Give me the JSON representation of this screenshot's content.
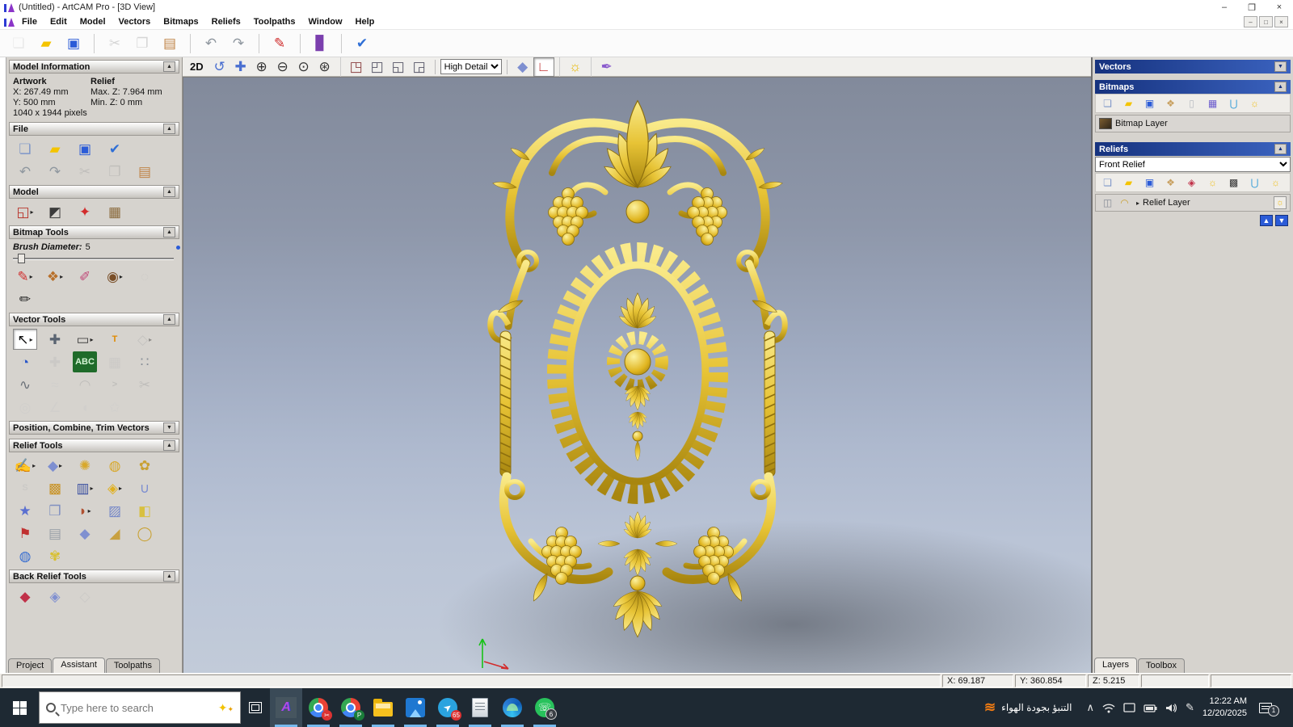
{
  "window": {
    "title": "(Untitled) - ArtCAM Pro - [3D View]"
  },
  "icons": {
    "collapse_up": "▲",
    "collapse_down": "▼",
    "flyout": "▸",
    "minimize": "–",
    "restore": "❐",
    "maximize": "□",
    "close": "×",
    "chevron_up": "∧",
    "pen": "✎"
  },
  "menu": {
    "items": [
      {
        "n": "menu-file",
        "t": "File"
      },
      {
        "n": "menu-edit",
        "t": "Edit"
      },
      {
        "n": "menu-model",
        "t": "Model"
      },
      {
        "n": "menu-vectors",
        "t": "Vectors"
      },
      {
        "n": "menu-bitmaps",
        "t": "Bitmaps"
      },
      {
        "n": "menu-reliefs",
        "t": "Reliefs"
      },
      {
        "n": "menu-toolpaths",
        "t": "Toolpaths"
      },
      {
        "n": "menu-window",
        "t": "Window"
      },
      {
        "n": "menu-help",
        "t": "Help"
      }
    ]
  },
  "main_toolbar": {
    "tools": [
      {
        "n": "new-model-button",
        "g": "❏",
        "c": "#c7d0df",
        "d": true
      },
      {
        "n": "open-model-button",
        "g": "▰",
        "c": "#f4c400"
      },
      {
        "n": "save-model-button",
        "g": "▣",
        "c": "#2b5bd7"
      },
      {
        "sep": true
      },
      {
        "n": "cut-button",
        "g": "✂",
        "c": "#98a0a8",
        "d": true
      },
      {
        "n": "copy-button",
        "g": "❐",
        "c": "#98a0a8",
        "d": true
      },
      {
        "n": "paste-button",
        "g": "▤",
        "c": "#c08448"
      },
      {
        "sep": true
      },
      {
        "n": "undo-button",
        "g": "↶",
        "c": "#8f979f"
      },
      {
        "n": "redo-button",
        "g": "↷",
        "c": "#8f979f"
      },
      {
        "sep": true
      },
      {
        "n": "notes-button",
        "g": "✎",
        "c": "#cf2b2b"
      },
      {
        "sep": true
      },
      {
        "n": "reference-help-button",
        "g": "▊",
        "c": "#7b3fae"
      },
      {
        "sep": true
      },
      {
        "n": "model-setup-button",
        "g": "✔",
        "c": "#2f6fd6"
      }
    ]
  },
  "assistant": {
    "model_information": {
      "title": "Model Information",
      "artwork_label": "Artwork",
      "relief_label": "Relief",
      "artwork_x": "X: 267.49 mm",
      "artwork_y": "Y: 500 mm",
      "relief_max": "Max. Z: 7.964 mm",
      "relief_min": "Min. Z: 0 mm",
      "pixels": "1040 x 1944 pixels"
    },
    "file": {
      "title": "File",
      "rows": [
        [
          {
            "n": "file-new-button",
            "g": "❏",
            "c": "#7d96c9"
          },
          {
            "n": "file-open-button",
            "g": "▰",
            "c": "#f4c400"
          },
          {
            "n": "file-save-button",
            "g": "▣",
            "c": "#2b5bd7"
          },
          {
            "n": "file-model-setup-button",
            "g": "✔",
            "c": "#2f6fd6"
          }
        ],
        [
          {
            "n": "file-undo-button",
            "g": "↶",
            "c": "#8f979f"
          },
          {
            "n": "file-redo-button",
            "g": "↷",
            "c": "#8f979f"
          },
          {
            "n": "file-cut-button",
            "g": "✂",
            "c": "#9aa2aa",
            "d": true
          },
          {
            "n": "file-copy-button",
            "g": "❐",
            "c": "#9aa2aa",
            "d": true
          },
          {
            "n": "file-paste-button",
            "g": "▤",
            "c": "#c08448"
          }
        ]
      ]
    },
    "model": {
      "title": "Model",
      "rows": [
        [
          {
            "n": "set-model-size-button",
            "g": "◱",
            "c": "#b8352c",
            "f": true
          },
          {
            "n": "adjust-model-lighting-button",
            "g": "◩",
            "c": "#3b3b3b"
          },
          {
            "n": "set-light-button",
            "g": "✦",
            "c": "#d22b2b"
          },
          {
            "n": "load-reference-image-button",
            "g": "▦",
            "c": "#8a6a3c"
          }
        ]
      ]
    },
    "bitmap_tools": {
      "title": "Bitmap Tools",
      "brush_label": "Brush Diameter:",
      "brush_value": "5",
      "rows": [
        [
          {
            "n": "paint-button",
            "g": "✎",
            "c": "#d03030",
            "f": true
          },
          {
            "n": "paint-selective-button",
            "g": "❖",
            "c": "#b8702a",
            "f": true
          },
          {
            "n": "colour-picker-button",
            "g": "✐",
            "c": "#c04878"
          },
          {
            "n": "palette-button",
            "g": "◉",
            "c": "#7a4f28",
            "f": true
          },
          {
            "n": "flood-fill-button",
            "g": "◌",
            "c": "#b8bcc2",
            "d": true
          }
        ],
        [
          {
            "n": "draw-button",
            "g": "✏",
            "c": "#222222"
          }
        ]
      ]
    },
    "vector_tools": {
      "title": "Vector Tools",
      "rows": [
        [
          {
            "n": "select-vectors-button",
            "g": "↖",
            "c": "#111111",
            "sel": true,
            "f": true
          },
          {
            "n": "transform-vectors-button",
            "g": "✚",
            "c": "#5a6472"
          },
          {
            "n": "create-rectangle-button",
            "g": "▭",
            "c": "#444444",
            "f": true
          },
          {
            "n": "create-text-button",
            "t": "T",
            "c": "#e08a00"
          },
          {
            "n": "envelope-distort-button",
            "g": "◇",
            "c": "#aaaabb",
            "d": true,
            "f": true
          }
        ],
        [
          {
            "n": "measure-button",
            "g": "◔",
            "c": "#2a57c9"
          },
          {
            "n": "snap-button",
            "g": "✚",
            "c": "#b8bcc2",
            "d": true
          },
          {
            "n": "text-block-button",
            "t": "ABC",
            "c": "#d6f5d6",
            "bg": "#1f6b2a"
          },
          {
            "n": "wireframe-button",
            "g": "▦",
            "c": "#b8bcc2",
            "d": true
          },
          {
            "n": "block-copy-button",
            "g": "∷",
            "c": "#8a9098"
          }
        ],
        [
          {
            "n": "create-polyline-button",
            "g": "∿",
            "c": "#6a7078"
          },
          {
            "n": "freehand-polyline-button",
            "g": "≈",
            "c": "#c6cad0",
            "d": true
          },
          {
            "n": "create-arc-button",
            "g": "◠",
            "c": "#9aa0a8",
            "d": true
          },
          {
            "n": "sharp-corner-button",
            "t": ">",
            "c": "#9aa0a8",
            "d": true
          },
          {
            "n": "cut-vector-button",
            "g": "✂",
            "c": "#9aa0a8",
            "d": true
          }
        ],
        [
          {
            "n": "revolve-vector-button",
            "g": "◎",
            "c": "#c6cad0",
            "d": true
          },
          {
            "n": "node-editing-button",
            "g": "∠",
            "c": "#c6cad0",
            "d": true
          },
          {
            "n": "mirror-vectors-button",
            "g": "◖",
            "c": "#c6cad0",
            "d": true
          },
          {
            "n": "create-star-button",
            "g": "✩",
            "c": "#c6cad0",
            "d": true
          }
        ]
      ]
    },
    "position_section": {
      "title": "Position, Combine, Trim Vectors"
    },
    "relief_tools": {
      "title": "Relief Tools",
      "rows": [
        [
          {
            "n": "sculpt-button",
            "g": "✍",
            "c": "#c9a132",
            "f": true
          },
          {
            "n": "zero-plane-button",
            "g": "◆",
            "c": "#7e8fd0",
            "f": true
          },
          {
            "n": "spin-relief-button",
            "g": "✺",
            "c": "#d8a82a"
          },
          {
            "n": "dome-relief-button",
            "g": "◍",
            "c": "#d8a82a"
          },
          {
            "n": "smooth-relief-button",
            "g": "✿",
            "c": "#c9a132"
          }
        ],
        [
          {
            "n": "sculpt-smooth-button",
            "t": "S",
            "c": "#b8bcc2",
            "d": true
          },
          {
            "n": "weave-wizard-button",
            "g": "▩",
            "c": "#c8901f"
          },
          {
            "n": "relief-clipart-button",
            "g": "▥",
            "c": "#3a4fa0",
            "f": true
          },
          {
            "n": "two-rail-sweep-button",
            "g": "◈",
            "c": "#e0b020",
            "f": true
          },
          {
            "n": "unwrap-relief-button",
            "g": "∪",
            "c": "#7e8fd0"
          }
        ],
        [
          {
            "n": "star-wizard-button",
            "g": "★",
            "c": "#5a6fd0"
          },
          {
            "n": "stamp-relief-button",
            "g": "❒",
            "c": "#8090c0"
          },
          {
            "n": "carve-relief-button",
            "g": "◗",
            "c": "#b05030",
            "f": true
          },
          {
            "n": "texture-relief-button",
            "g": "▨",
            "c": "#7285c8"
          },
          {
            "n": "offset-relief-button",
            "g": "◧",
            "c": "#d8c040"
          }
        ],
        [
          {
            "n": "turn-relief-button",
            "g": "⚑",
            "c": "#c03030"
          },
          {
            "n": "column-relief-button",
            "g": "▤",
            "c": "#9aa0a8"
          },
          {
            "n": "pillow-relief-button",
            "g": "◆",
            "c": "#8090d0"
          },
          {
            "n": "angled-plane-button",
            "g": "◢",
            "c": "#c8a040"
          },
          {
            "n": "ring-wizard-button",
            "g": "◯",
            "c": "#c9a132"
          }
        ],
        [
          {
            "n": "texture-sphere-button",
            "g": "◍",
            "c": "#3a6fd0"
          },
          {
            "n": "wrap-flower-button",
            "g": "✾",
            "c": "#d8c030"
          }
        ]
      ]
    },
    "back_relief_tools": {
      "title": "Back Relief Tools",
      "rows": [
        [
          {
            "n": "back-relief-invert-button",
            "g": "◆",
            "c": "#c03048"
          },
          {
            "n": "back-relief-offset-button",
            "g": "◈",
            "c": "#8090d0"
          },
          {
            "n": "back-relief-blank-button",
            "g": "◇",
            "c": "#b8bcc2",
            "d": true
          }
        ]
      ]
    },
    "tabs": {
      "project": "Project",
      "assistant": "Assistant",
      "toolpaths": "Toolpaths"
    }
  },
  "canvas": {
    "toolbar": {
      "label_2d": "2D",
      "detail_selector": "High Detail",
      "nav_tools": [
        {
          "n": "twiddle-view-button",
          "g": "↺",
          "c": "#4a6fd0"
        },
        {
          "n": "pan-view-button",
          "g": "✚",
          "c": "#4a6fd0"
        },
        {
          "n": "zoom-in-button",
          "g": "⊕",
          "c": "#333333"
        },
        {
          "n": "zoom-out-button",
          "g": "⊖",
          "c": "#333333"
        },
        {
          "n": "zoom-previous-button",
          "g": "⊙",
          "c": "#333333"
        },
        {
          "n": "zoom-fit-button",
          "g": "⊛",
          "c": "#333333"
        },
        {
          "sep": true
        },
        {
          "n": "view-top-button",
          "g": "◳",
          "c": "#8a4040"
        },
        {
          "n": "view-iso1-button",
          "g": "◰",
          "c": "#555566"
        },
        {
          "n": "view-iso2-button",
          "g": "◱",
          "c": "#555566"
        },
        {
          "n": "view-iso3-button",
          "g": "◲",
          "c": "#555566"
        }
      ],
      "right_tools": [
        {
          "n": "toggle-relief-view-button",
          "g": "◆",
          "c": "#7e8fd0"
        },
        {
          "n": "draw-axes-button",
          "g": "∟",
          "c": "#c03030",
          "sel": true
        },
        {
          "sep": true
        },
        {
          "n": "toggle-lighting-button",
          "g": "☼",
          "c": "#e8b800"
        },
        {
          "sep": true
        },
        {
          "n": "shade-relief-button",
          "g": "✒",
          "c": "#8a5acd"
        }
      ]
    }
  },
  "right_panel": {
    "vectors": {
      "title": "Vectors"
    },
    "bitmaps": {
      "title": "Bitmaps",
      "layer_name": "Bitmap Layer",
      "tools": [
        {
          "n": "new-bitmap-layer-button",
          "g": "❏",
          "c": "#7d96c9"
        },
        {
          "n": "open-bitmap-layer-button",
          "g": "▰",
          "c": "#f4c400"
        },
        {
          "n": "save-bitmap-layer-button",
          "g": "▣",
          "c": "#2b5bd7"
        },
        {
          "n": "bitmap-layer-tool-button",
          "g": "❖",
          "c": "#c8a060"
        },
        {
          "n": "clear-bitmap-layer-button",
          "g": "▯",
          "c": "#b8bcc2"
        },
        {
          "n": "edit-bitmap-layer-button",
          "g": "▦",
          "c": "#6a5acd"
        },
        {
          "n": "delete-bitmap-layer-button",
          "g": "⋃",
          "c": "#3a9fd8"
        },
        {
          "n": "toggle-bitmaps-visibility-button",
          "g": "☼",
          "c": "#f0c020"
        }
      ]
    },
    "reliefs": {
      "title": "Reliefs",
      "selected_relief": "Front Relief",
      "layer_name": "Relief Layer",
      "tools": [
        {
          "n": "new-relief-layer-button",
          "g": "❏",
          "c": "#7d96c9"
        },
        {
          "n": "open-relief-layer-button",
          "g": "▰",
          "c": "#f4c400"
        },
        {
          "n": "save-relief-layer-button",
          "g": "▣",
          "c": "#2b5bd7"
        },
        {
          "n": "relief-layer-tool-button",
          "g": "❖",
          "c": "#c8a060"
        },
        {
          "n": "merge-relief-layers-button",
          "g": "◈",
          "c": "#c03048"
        },
        {
          "n": "relief-visibility-button",
          "g": "☼",
          "c": "#f0c020"
        },
        {
          "n": "greyscale-preview-button",
          "g": "▩",
          "c": "#333333"
        },
        {
          "n": "delete-relief-layer-button",
          "g": "⋃",
          "c": "#3a9fd8"
        },
        {
          "n": "toggle-reliefs-visibility-button",
          "g": "☼",
          "c": "#f0c020"
        }
      ],
      "layer_tools": [
        {
          "n": "relief-layer-mode-button",
          "g": "◫",
          "c": "#8a8f98"
        },
        {
          "n": "add-relief-layer-button",
          "g": "◠",
          "c": "#c9a132"
        }
      ]
    },
    "tabs": {
      "layers": "Layers",
      "toolbox": "Toolbox"
    }
  },
  "status_bar": {
    "x": "X: 69.187",
    "y": "Y: 360.854",
    "z": "Z: 5.215"
  },
  "taskbar": {
    "search_placeholder": "Type here to search",
    "weather_text": "التنبؤ بجودة الهواء",
    "time": "12:22 AM",
    "date": "12/20/2025",
    "telegram_badge": "65",
    "whatsapp_badge": "6",
    "notification_badge": "1",
    "chrome_profile_letter": "P"
  },
  "colors": {
    "accent_blue": "#2b5bd7",
    "header_blue": "#16327e",
    "gold": "#e3bc2a",
    "taskbar_bg": "#1e2933"
  }
}
